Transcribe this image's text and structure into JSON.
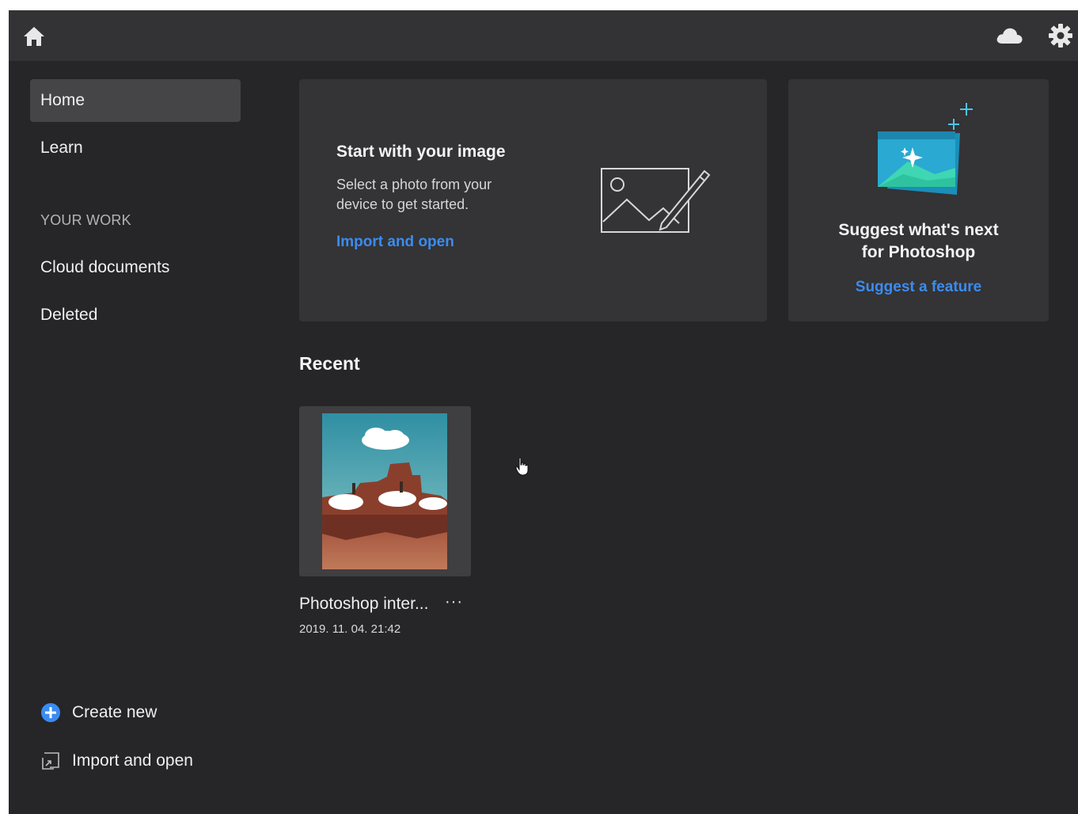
{
  "topbar": {
    "icons": [
      "home-icon",
      "cloud-icon",
      "gear-icon"
    ]
  },
  "sidebar": {
    "items": [
      {
        "label": "Home",
        "active": true
      },
      {
        "label": "Learn",
        "active": false
      }
    ],
    "section_label": "YOUR WORK",
    "work_items": [
      {
        "label": "Cloud documents"
      },
      {
        "label": "Deleted"
      }
    ],
    "bottom_actions": [
      {
        "label": "Create new",
        "icon": "plus-circle-icon"
      },
      {
        "label": "Import and open",
        "icon": "import-icon"
      }
    ]
  },
  "start_card": {
    "title": "Start with your image",
    "description": "Select a photo from your device to get started.",
    "link": "Import and open",
    "icon": "image-pen-icon"
  },
  "suggest_card": {
    "title_line1": "Suggest what's next",
    "title_line2": "for Photoshop",
    "link": "Suggest a feature",
    "icon": "sparkle-window-icon"
  },
  "recent": {
    "title": "Recent",
    "documents": [
      {
        "name": "Photoshop inter...",
        "date": "2019. 11. 04. 21:42",
        "more": "···"
      }
    ]
  },
  "colors": {
    "accent": "#3b8cf0",
    "background": "#262527",
    "topbar": "#333234",
    "card": "#343335"
  }
}
